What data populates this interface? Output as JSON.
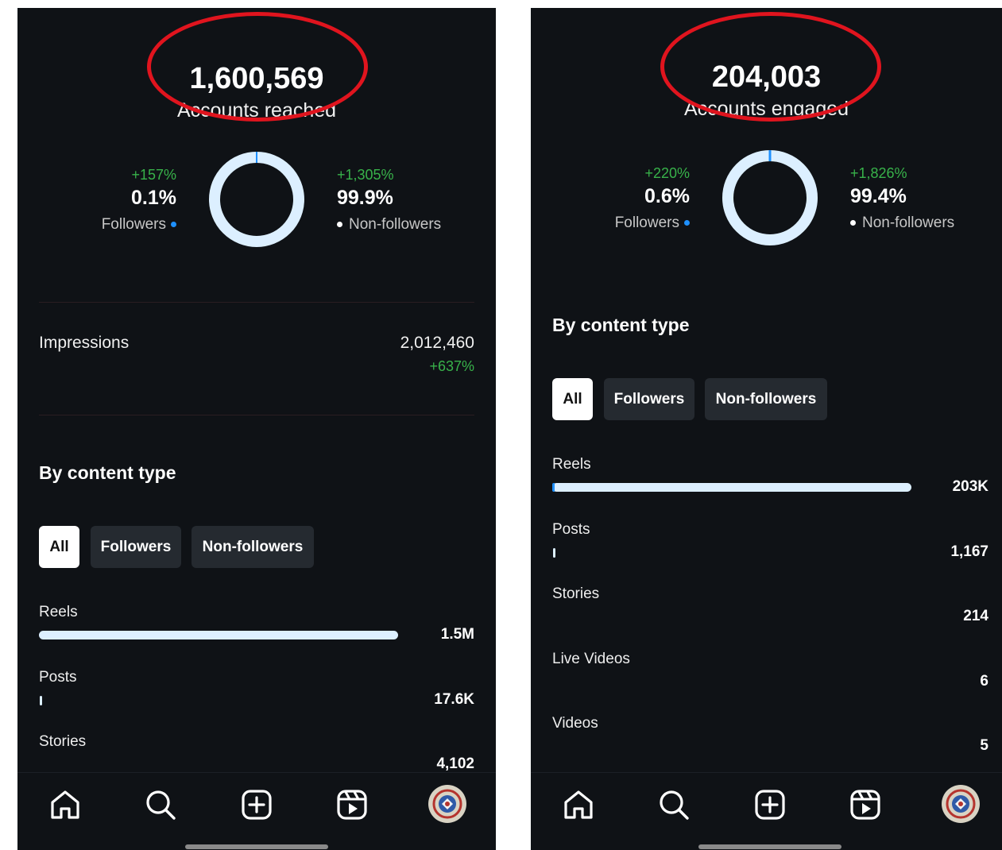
{
  "panels": [
    {
      "big_number": "1,600,569",
      "big_label": "Accounts reached",
      "followers": {
        "change": "+157%",
        "percent": "0.1%",
        "label": "Followers",
        "fraction": 0.001
      },
      "non_followers": {
        "change": "+1,305%",
        "percent": "99.9%",
        "label": "Non-followers",
        "fraction": 0.999
      },
      "impressions": {
        "label": "Impressions",
        "value": "2,012,460",
        "change": "+637%"
      },
      "section_title": "By content type",
      "filters": [
        "All",
        "Followers",
        "Non-followers"
      ],
      "content": [
        {
          "label": "Reels",
          "value": "1.5M",
          "fraction": 0.98
        },
        {
          "label": "Posts",
          "value": "17.6K",
          "fraction": 0.0
        },
        {
          "label": "Stories",
          "value": "4,102",
          "fraction": 0.0
        }
      ]
    },
    {
      "big_number": "204,003",
      "big_label": "Accounts engaged",
      "followers": {
        "change": "+220%",
        "percent": "0.6%",
        "label": "Followers",
        "fraction": 0.006
      },
      "non_followers": {
        "change": "+1,826%",
        "percent": "99.4%",
        "label": "Non-followers",
        "fraction": 0.994
      },
      "section_title": "By content type",
      "filters": [
        "All",
        "Followers",
        "Non-followers"
      ],
      "content": [
        {
          "label": "Reels",
          "value": "203K",
          "fraction": 0.99
        },
        {
          "label": "Posts",
          "value": "1,167",
          "fraction": 0.0
        },
        {
          "label": "Stories",
          "value": "214",
          "fraction": 0.0
        },
        {
          "label": "Live Videos",
          "value": "6",
          "fraction": 0.0
        },
        {
          "label": "Videos",
          "value": "5",
          "fraction": 0.0
        }
      ]
    }
  ],
  "nav": [
    "home-icon",
    "search-icon",
    "create-icon",
    "reels-icon",
    "profile-avatar"
  ],
  "colors": {
    "accent_green": "#38b24a",
    "accent_blue": "#1e90ff",
    "bar": "#dcefff",
    "highlight_oval": "#e0141e",
    "background": "#0f1216"
  }
}
